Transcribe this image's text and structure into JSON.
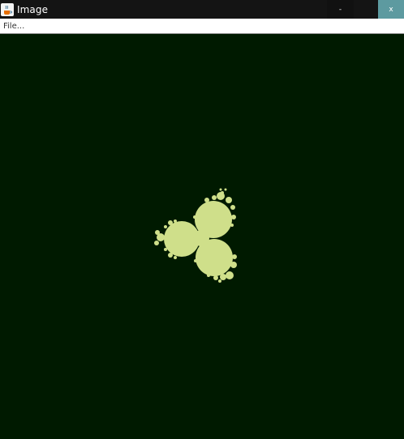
{
  "window": {
    "title": "Image",
    "minimize_label": "-",
    "close_label": "x",
    "app_icon": "java-cup-icon"
  },
  "menubar": {
    "items": [
      {
        "label": "File..."
      }
    ]
  },
  "canvas": {
    "background_color": "#001a00",
    "fractal_color": "#cfdf8a",
    "content": "fractal-image"
  }
}
